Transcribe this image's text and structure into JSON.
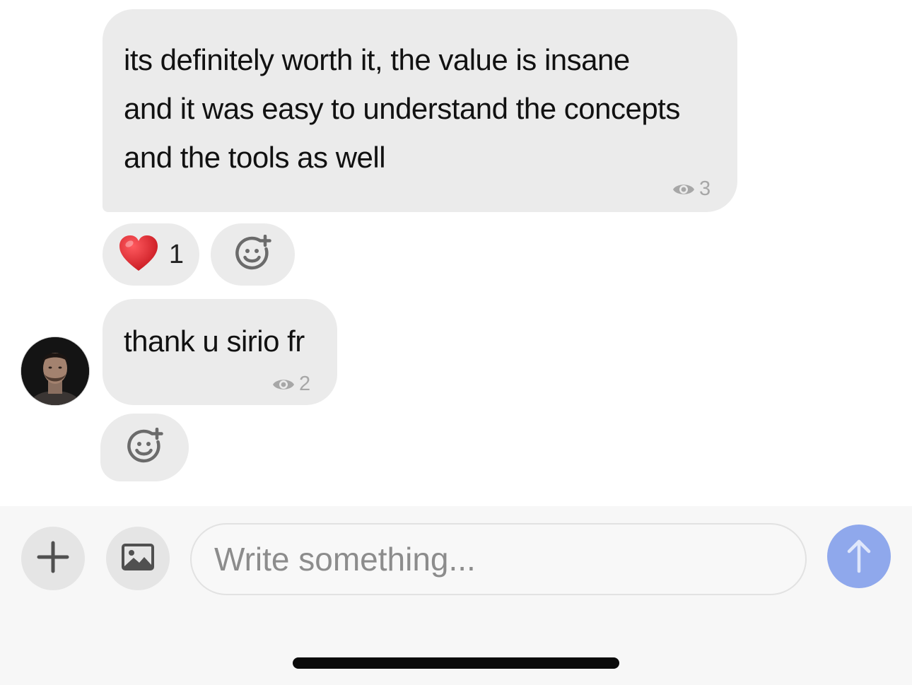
{
  "messages": [
    {
      "lines": [
        "its definitely worth it, the value is insane",
        "and it was easy to understand the concepts",
        "and the tools as well"
      ],
      "views": "3",
      "reaction": {
        "emoji": "heart",
        "count": "1"
      }
    },
    {
      "lines": [
        "thank u sirio fr"
      ],
      "views": "2"
    }
  ],
  "composer": {
    "placeholder": "Write something..."
  },
  "colors": {
    "bubble": "#ebebeb",
    "send_button": "#8fa8ec",
    "heart": "#e0282e",
    "views_text": "#a7a7a7"
  },
  "icons": [
    "eye-icon",
    "heart-emoji-icon",
    "add-reaction-icon",
    "plus-icon",
    "image-icon",
    "send-arrow-icon"
  ]
}
